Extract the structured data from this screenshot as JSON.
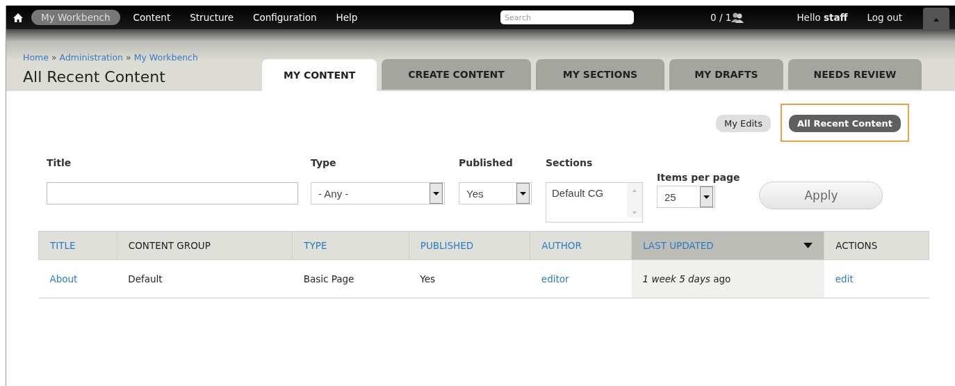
{
  "toolbar": {
    "items": [
      {
        "label": "My Workbench",
        "selected": true
      },
      {
        "label": "Content",
        "selected": false
      },
      {
        "label": "Structure",
        "selected": false
      },
      {
        "label": "Configuration",
        "selected": false
      },
      {
        "label": "Help",
        "selected": false
      }
    ],
    "search": {
      "placeholder": "Search"
    },
    "counter": "0 / 1",
    "greeting": "Hello **staff**",
    "logout": "Log out"
  },
  "breadcrumb": {
    "separator": "»",
    "items": [
      "Home",
      "Administration",
      "My Workbench"
    ]
  },
  "page_title": "All Recent Content",
  "tabs": [
    {
      "label": "MY CONTENT",
      "selected": true
    },
    {
      "label": "CREATE CONTENT",
      "selected": false
    },
    {
      "label": "MY SECTIONS",
      "selected": false
    },
    {
      "label": "MY DRAFTS",
      "selected": false
    },
    {
      "label": "NEEDS REVIEW",
      "selected": false
    }
  ],
  "secondary_tabs": [
    {
      "label": "My Edits",
      "selected": false,
      "highlighted": false
    },
    {
      "label": "All Recent Content",
      "selected": true,
      "highlighted": true
    }
  ],
  "filters": [
    {
      "kind": "text",
      "label": "Title"
    },
    {
      "kind": "select",
      "label": "Type",
      "value": "- Any -"
    },
    {
      "kind": "select",
      "label": "Published",
      "value": "Yes"
    },
    {
      "kind": "listbox",
      "label": "Sections",
      "value": "Default CG"
    },
    {
      "kind": "select",
      "label": "Items per page",
      "value": "25"
    }
  ],
  "apply": "Apply",
  "table": {
    "columns": [
      {
        "label": "TITLE",
        "sortable": true,
        "sorted": false
      },
      {
        "label": "CONTENT GROUP",
        "sortable": false,
        "sorted": false
      },
      {
        "label": "TYPE",
        "sortable": true,
        "sorted": false
      },
      {
        "label": "PUBLISHED",
        "sortable": true,
        "sorted": false
      },
      {
        "label": "AUTHOR",
        "sortable": true,
        "sorted": false
      },
      {
        "label": "LAST UPDATED",
        "sortable": true,
        "sorted": true
      },
      {
        "label": "ACTIONS",
        "sortable": false,
        "sorted": false
      }
    ],
    "rows": [
      {
        "cells": [
          {
            "kind": "link",
            "text": "About"
          },
          {
            "kind": "text",
            "text": "Default"
          },
          {
            "kind": "text",
            "text": "Basic Page"
          },
          {
            "kind": "text",
            "text": "Yes"
          },
          {
            "kind": "link",
            "text": "editor"
          },
          {
            "kind": "text",
            "text": "*1 week 5 days* ago"
          },
          {
            "kind": "link",
            "text": "edit"
          }
        ]
      }
    ]
  }
}
